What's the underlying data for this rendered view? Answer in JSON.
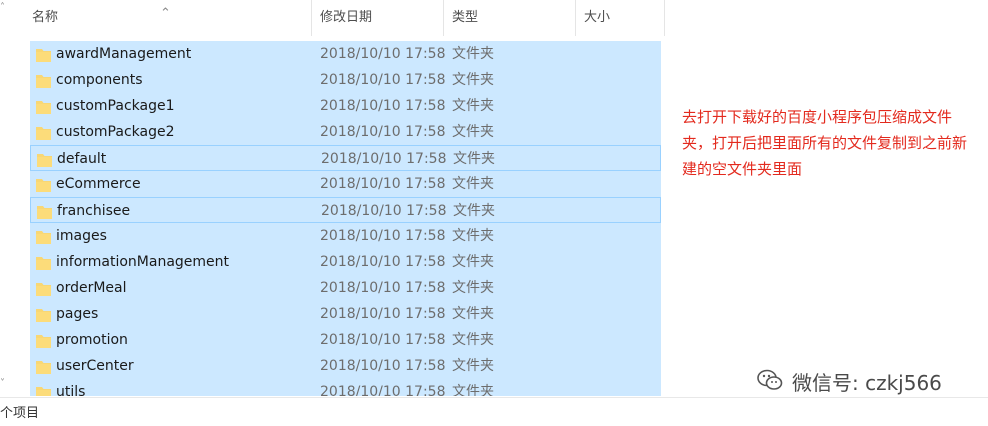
{
  "columns": {
    "name": "名称",
    "date": "修改日期",
    "type": "类型",
    "size": "大小"
  },
  "items": [
    {
      "name": "awardManagement",
      "date": "2018/10/10 17:58",
      "type": "文件夹"
    },
    {
      "name": "components",
      "date": "2018/10/10 17:58",
      "type": "文件夹"
    },
    {
      "name": "customPackage1",
      "date": "2018/10/10 17:58",
      "type": "文件夹"
    },
    {
      "name": "customPackage2",
      "date": "2018/10/10 17:58",
      "type": "文件夹"
    },
    {
      "name": "default",
      "date": "2018/10/10 17:58",
      "type": "文件夹"
    },
    {
      "name": "eCommerce",
      "date": "2018/10/10 17:58",
      "type": "文件夹"
    },
    {
      "name": "franchisee",
      "date": "2018/10/10 17:58",
      "type": "文件夹"
    },
    {
      "name": "images",
      "date": "2018/10/10 17:58",
      "type": "文件夹"
    },
    {
      "name": "informationManagement",
      "date": "2018/10/10 17:58",
      "type": "文件夹"
    },
    {
      "name": "orderMeal",
      "date": "2018/10/10 17:58",
      "type": "文件夹"
    },
    {
      "name": "pages",
      "date": "2018/10/10 17:58",
      "type": "文件夹"
    },
    {
      "name": "promotion",
      "date": "2018/10/10 17:58",
      "type": "文件夹"
    },
    {
      "name": "userCenter",
      "date": "2018/10/10 17:58",
      "type": "文件夹"
    },
    {
      "name": "utils",
      "date": "2018/10/10 17:58",
      "type": "文件夹"
    }
  ],
  "status": {
    "text": "个项目"
  },
  "annotation": {
    "text": "去打开下载好的百度小程序包压缩成文件夹，打开后把里面所有的文件复制到之前新建的空文件夹里面"
  },
  "watermark": {
    "text": "微信号: czkj566"
  },
  "colors": {
    "selection": "#cce8ff",
    "selection_border": "#99d1ff",
    "folder": "#f8d775",
    "annotation": "#e32a1e"
  },
  "icons": {
    "folder": "folder-icon",
    "sort": "sort-ascending-icon",
    "wechat": "wechat-icon"
  }
}
